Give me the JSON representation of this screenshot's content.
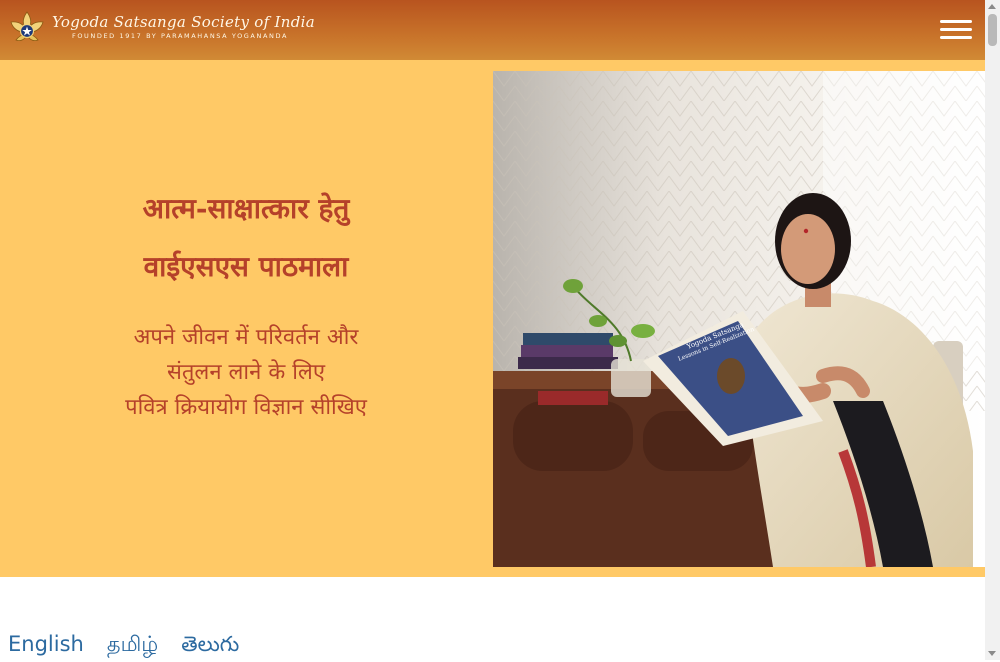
{
  "header": {
    "org_name": "Yogoda Satsanga Society of India",
    "org_tagline": "FOUNDED 1917 BY PARAMAHANSA YOGANANDA",
    "logo_icon": "lotus-star-emblem-icon",
    "menu_icon": "hamburger-menu-icon"
  },
  "hero": {
    "title_line1": "आत्म-साक्षात्कार हेतु",
    "title_line2": "वाईएसएस पाठमाला",
    "subtitle_line1": "अपने जीवन में परिवर्तन और",
    "subtitle_line2": "संतुलन लाने के लिए",
    "subtitle_line3": "पवित्र क्रियायोग विज्ञान सीखिए",
    "booklet_cover_title": "Yogoda Satsanga",
    "booklet_cover_subtitle": "Lessons in Self-Realization"
  },
  "languages": [
    "English",
    "தமிழ்",
    "తెలుగు"
  ],
  "colors": {
    "header_start": "#b8541f",
    "header_end": "#d18a35",
    "hero_bg": "#ffc966",
    "hero_text": "#b5412a",
    "link": "#2c6aa0"
  }
}
